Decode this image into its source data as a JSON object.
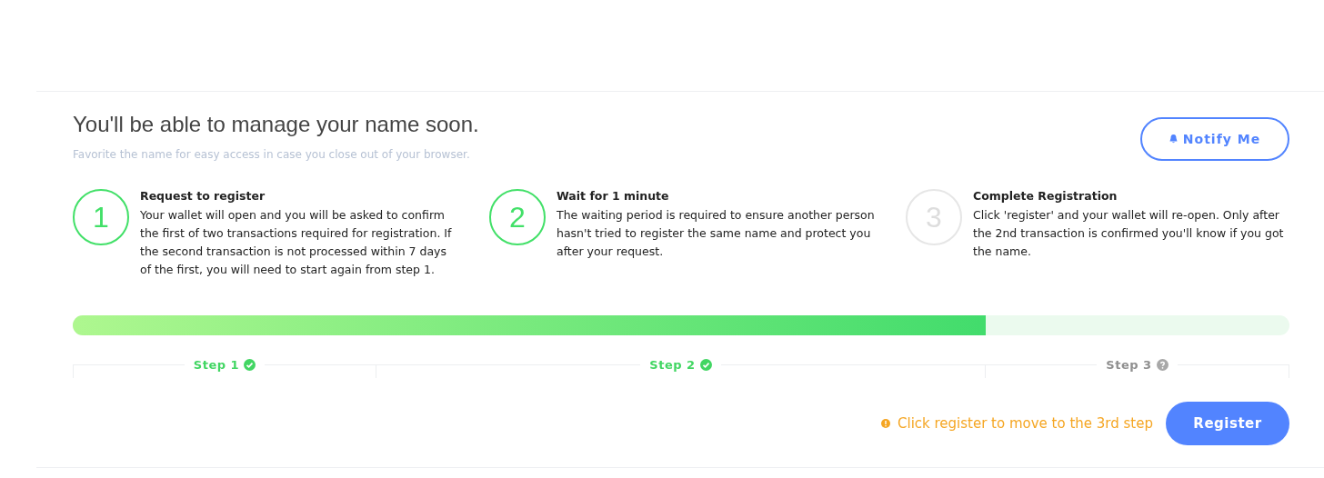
{
  "header": {
    "title": "You'll be able to manage your name soon.",
    "subtitle": "Favorite the name for easy access in case you close out of your browser.",
    "notify_button": "Notify Me"
  },
  "steps": [
    {
      "number": "1",
      "title": "Request to register",
      "text": "Your wallet will open and you will be asked to confirm the first of two transactions required for registration. If the second transaction is not processed within 7 days of the first, you will need to start again from step 1.",
      "done": true
    },
    {
      "number": "2",
      "title": "Wait for 1 minute",
      "text": "The waiting period is required to ensure another person hasn't tried to register the same name and protect you after your request.",
      "done": true
    },
    {
      "number": "3",
      "title": "Complete Registration",
      "text": "Click 'register' and your wallet will re-open. Only after the 2nd transaction is confirmed you'll know if you got the name.",
      "done": false
    }
  ],
  "progress": {
    "level": 0.75
  },
  "step_labels": [
    {
      "label": "Step 1",
      "done": true
    },
    {
      "label": "Step 2",
      "done": true
    },
    {
      "label": "Step 3",
      "done": false
    }
  ],
  "footer": {
    "hint": "Click register to move to the 3rd step",
    "button": "Register"
  }
}
